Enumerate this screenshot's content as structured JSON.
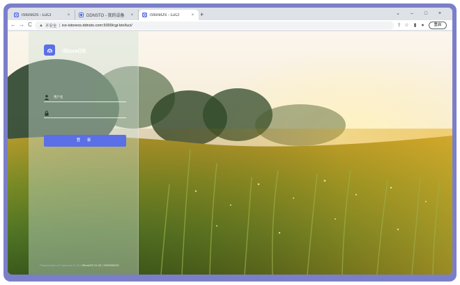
{
  "browser": {
    "tabs": [
      {
        "title": "iStoreOS - LuCI",
        "close": "×",
        "active": false
      },
      {
        "title": "DDNSTO - 我的设备",
        "close": "×",
        "active": false
      },
      {
        "title": "iStoreOS - LuCI",
        "close": "×",
        "active": true
      }
    ],
    "new_tab": "+",
    "window_controls": {
      "minimize": "–",
      "maximize": "□",
      "close": "×",
      "tabs_menu": "⌄"
    },
    "toolbar": {
      "back": "←",
      "forward": "→",
      "reload": "C",
      "security_label": "不安全",
      "url": "ice-istoreos.ddnsto.com:5000/cgi-bin/luci/",
      "restart_label": "重启"
    }
  },
  "login": {
    "brand": "iStoreOS",
    "logo_text": "iStoreOS",
    "username_placeholder": "用户名",
    "password_placeholder": "",
    "submit_label": "登 录",
    "footer_link": "Powered by LuCI openwrt-21.02",
    "footer_text": " / iStoreOS 21.02 / 2022080319"
  },
  "colors": {
    "accent": "#5b6fe6",
    "frame": "#7b7fc9"
  }
}
